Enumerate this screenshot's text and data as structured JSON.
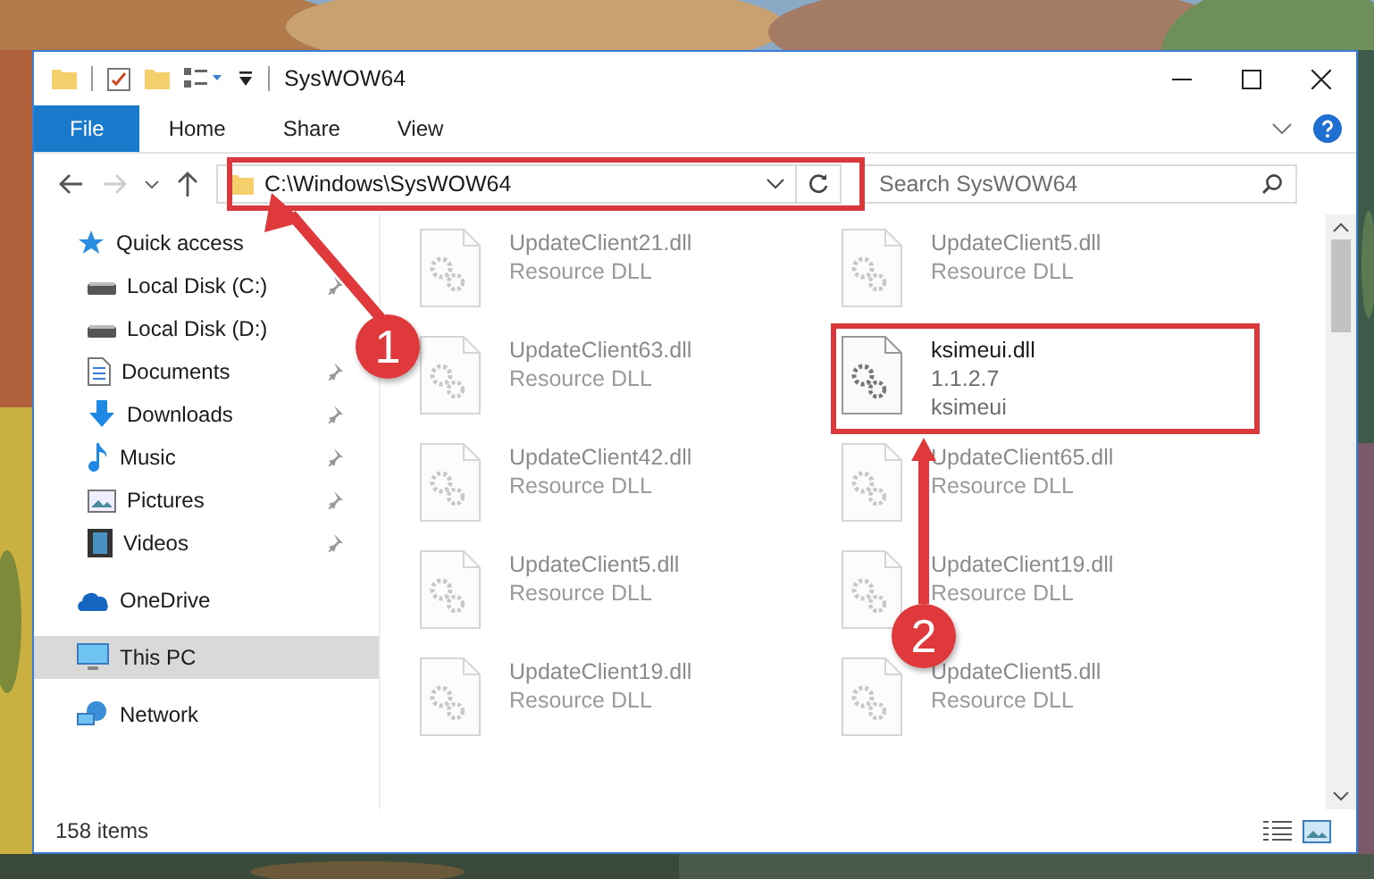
{
  "window": {
    "title": "SysWOW64"
  },
  "ribbon": {
    "tabs": [
      {
        "label": "File",
        "selected": true
      },
      {
        "label": "Home",
        "selected": false
      },
      {
        "label": "Share",
        "selected": false
      },
      {
        "label": "View",
        "selected": false
      }
    ]
  },
  "address_bar": {
    "path": "C:\\Windows\\SysWOW64"
  },
  "search": {
    "placeholder": "Search SysWOW64"
  },
  "nav": {
    "items": [
      {
        "label": "Quick access",
        "kind": "star",
        "selected": false,
        "children": [
          {
            "label": "Local Disk (C:)",
            "kind": "disk",
            "pinned": true
          },
          {
            "label": "Local Disk (D:)",
            "kind": "disk",
            "pinned": false
          },
          {
            "label": "Documents",
            "kind": "documents",
            "pinned": true
          },
          {
            "label": "Downloads",
            "kind": "downloads",
            "pinned": true
          },
          {
            "label": "Music",
            "kind": "music",
            "pinned": true
          },
          {
            "label": "Pictures",
            "kind": "pictures",
            "pinned": true
          },
          {
            "label": "Videos",
            "kind": "videos",
            "pinned": true
          }
        ]
      },
      {
        "label": "OneDrive",
        "kind": "cloud",
        "selected": false
      },
      {
        "label": "This PC",
        "kind": "pc",
        "selected": true
      },
      {
        "label": "Network",
        "kind": "network",
        "selected": false
      }
    ]
  },
  "files": [
    {
      "name": "UpdateClient21.dll",
      "lines": [
        "Resource DLL"
      ],
      "faded": true
    },
    {
      "name": "UpdateClient5.dll",
      "lines": [
        "Resource DLL"
      ],
      "faded": true
    },
    {
      "name": "UpdateClient63.dll",
      "lines": [
        "Resource DLL"
      ],
      "faded": true
    },
    {
      "name": "ksimeui.dll",
      "lines": [
        "1.1.2.7",
        "ksimeui"
      ],
      "faded": false
    },
    {
      "name": "UpdateClient42.dll",
      "lines": [
        "Resource DLL"
      ],
      "faded": true
    },
    {
      "name": "UpdateClient65.dll",
      "lines": [
        "Resource DLL"
      ],
      "faded": true
    },
    {
      "name": "UpdateClient5.dll",
      "lines": [
        "Resource DLL"
      ],
      "faded": true
    },
    {
      "name": "UpdateClient19.dll",
      "lines": [
        "Resource DLL"
      ],
      "faded": true
    },
    {
      "name": "UpdateClient19.dll",
      "lines": [
        "Resource DLL"
      ],
      "faded": true
    },
    {
      "name": "UpdateClient5.dll",
      "lines": [
        "Resource DLL"
      ],
      "faded": true
    }
  ],
  "status_bar": {
    "count": "158 items"
  },
  "callouts": [
    {
      "number": "1"
    },
    {
      "number": "2"
    }
  ]
}
